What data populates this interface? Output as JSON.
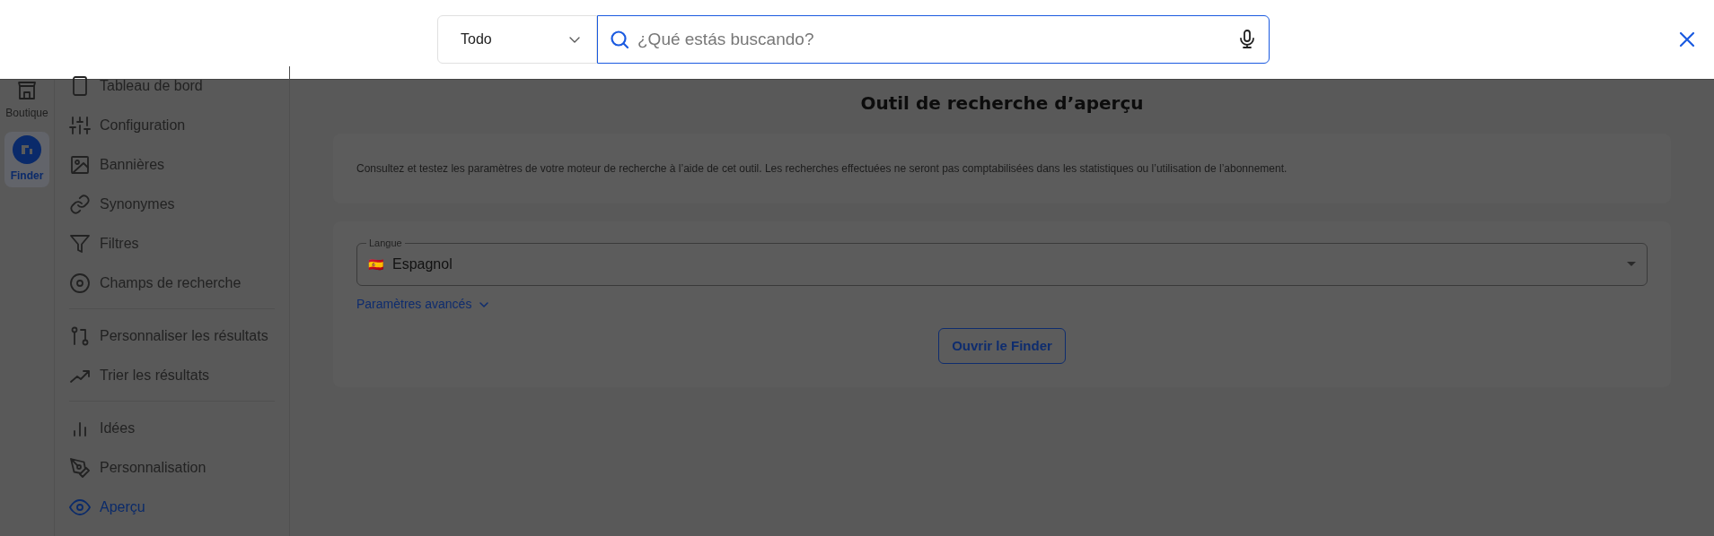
{
  "search_bar": {
    "scope": "Todo",
    "placeholder": "¿Qué estás buscando?"
  },
  "rail": [
    {
      "label": "Boutique",
      "kind": "store",
      "selected": false
    },
    {
      "label": "Finder",
      "kind": "finder",
      "selected": true
    }
  ],
  "sidebar": {
    "groups": [
      [
        {
          "label": "Tableau de bord",
          "kind": "tablet",
          "selected": false
        },
        {
          "label": "Configuration",
          "kind": "sliders",
          "selected": false
        },
        {
          "label": "Bannières",
          "kind": "image",
          "selected": false
        },
        {
          "label": "Synonymes",
          "kind": "link",
          "selected": false
        },
        {
          "label": "Filtres",
          "kind": "filter",
          "selected": false
        },
        {
          "label": "Champs de recherche",
          "kind": "target",
          "selected": false
        }
      ],
      [
        {
          "label": "Personnaliser les résultats",
          "kind": "branch",
          "selected": false
        },
        {
          "label": "Trier les résultats",
          "kind": "trend",
          "selected": false
        }
      ],
      [
        {
          "label": "Idées",
          "kind": "bars",
          "selected": false
        },
        {
          "label": "Personnalisation",
          "kind": "pen",
          "selected": false
        },
        {
          "label": "Aperçu",
          "kind": "eye",
          "selected": true
        }
      ]
    ]
  },
  "page": {
    "title": "Outil de recherche d’aperçu",
    "description": "Consultez et testez les paramètres de votre moteur de recherche à l’aide de cet outil. Les recherches effectuées ne seront pas comptabilisées dans les statistiques ou l’utilisation de l’abonnement.",
    "language_field": {
      "label": "Langue",
      "flag": "🇪🇸",
      "value": "Espagnol"
    },
    "advanced_link": "Paramètres avancés",
    "open_button": "Ouvrir le Finder"
  }
}
